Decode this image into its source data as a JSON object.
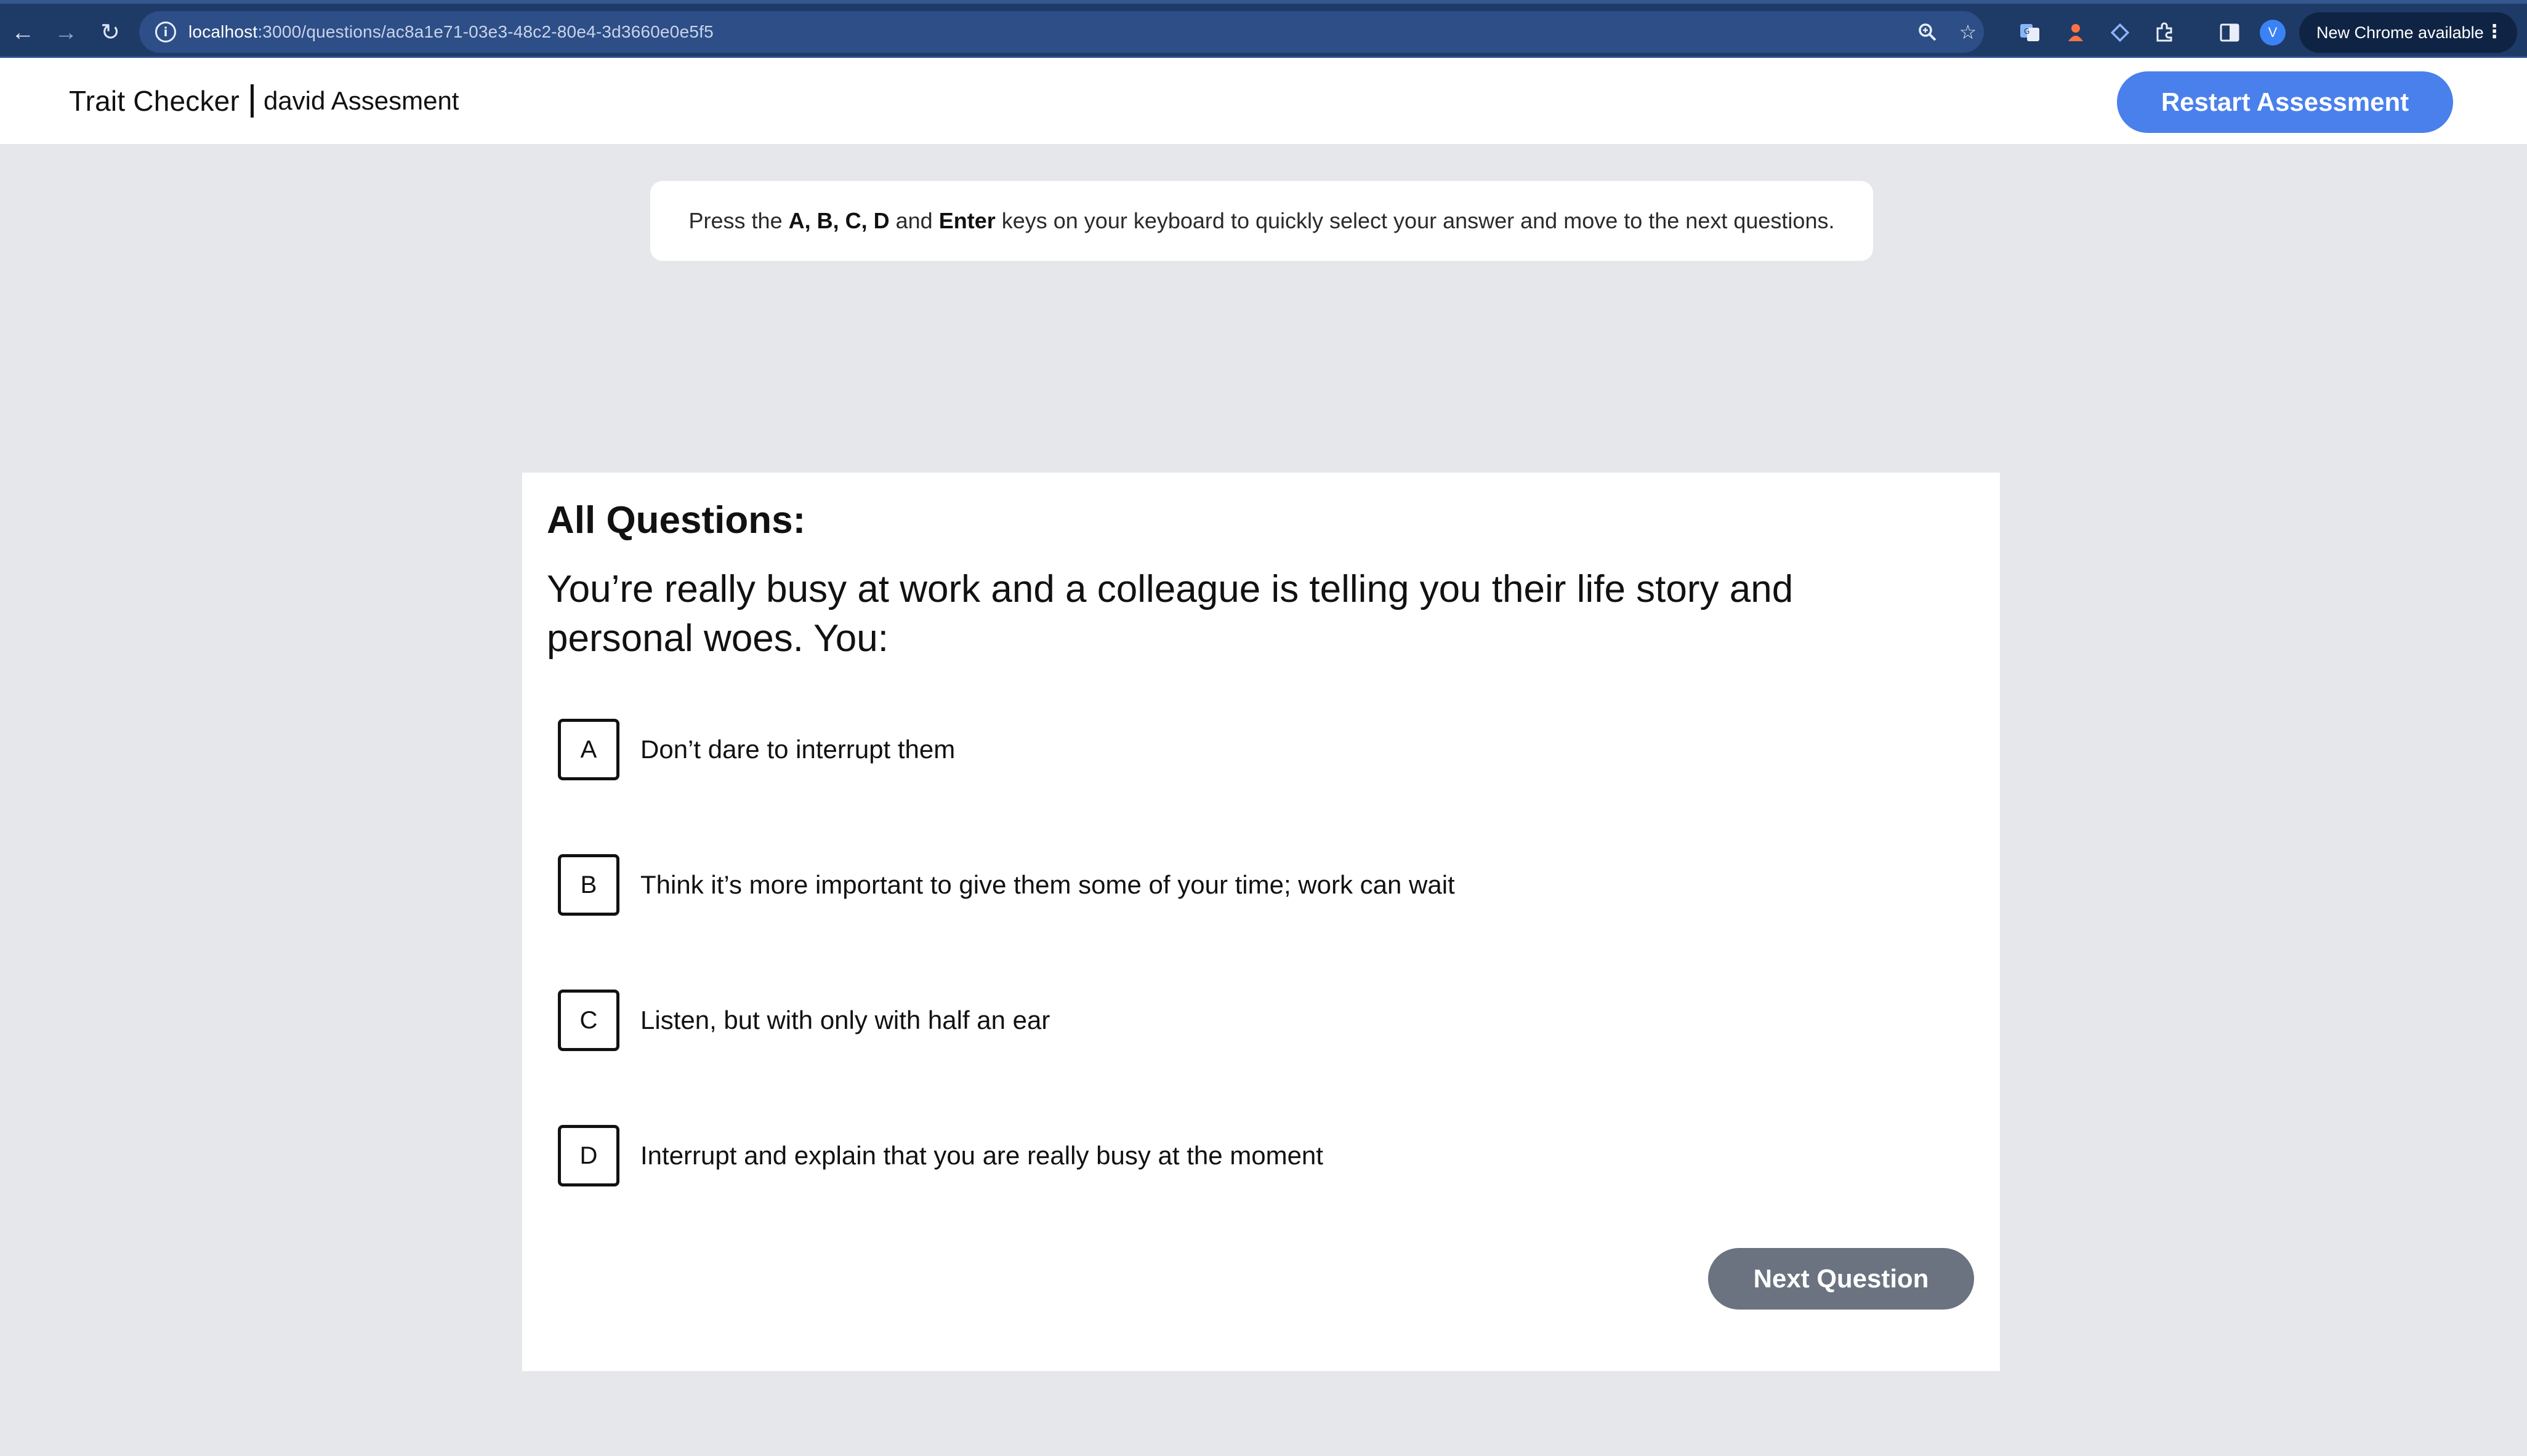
{
  "browser": {
    "url_host": "localhost",
    "url_path": ":3000/questions/ac8a1e71-03e3-48c2-80e4-3d3660e0e5f5",
    "profile_initial": "V",
    "update_label": "New Chrome available"
  },
  "header": {
    "app_name": "Trait Checker",
    "assessment_name": "david Assesment",
    "restart_label": "Restart Assessment"
  },
  "hint": {
    "prefix": "Press the ",
    "keys": "A, B, C, D",
    "middle": " and ",
    "enter_key": "Enter",
    "suffix": " keys on your keyboard to quickly select your answer and move to the next questions."
  },
  "question": {
    "section_title": "All Questions:",
    "text": "You’re really busy at work and a colleague is telling you their life story and personal woes. You:",
    "options": [
      {
        "letter": "A",
        "label": "Don’t dare to interrupt them"
      },
      {
        "letter": "B",
        "label": "Think it’s more important to give them some of your time; work can wait"
      },
      {
        "letter": "C",
        "label": "Listen, but with only with half an ear"
      },
      {
        "letter": "D",
        "label": "Interrupt and explain that you are really busy at the moment"
      }
    ],
    "next_label": "Next Question"
  },
  "colors": {
    "primary": "#4a80ec",
    "next_button": "#6b7280",
    "page_background": "#e5e7eb",
    "chrome_bar": "#1e3a66"
  }
}
